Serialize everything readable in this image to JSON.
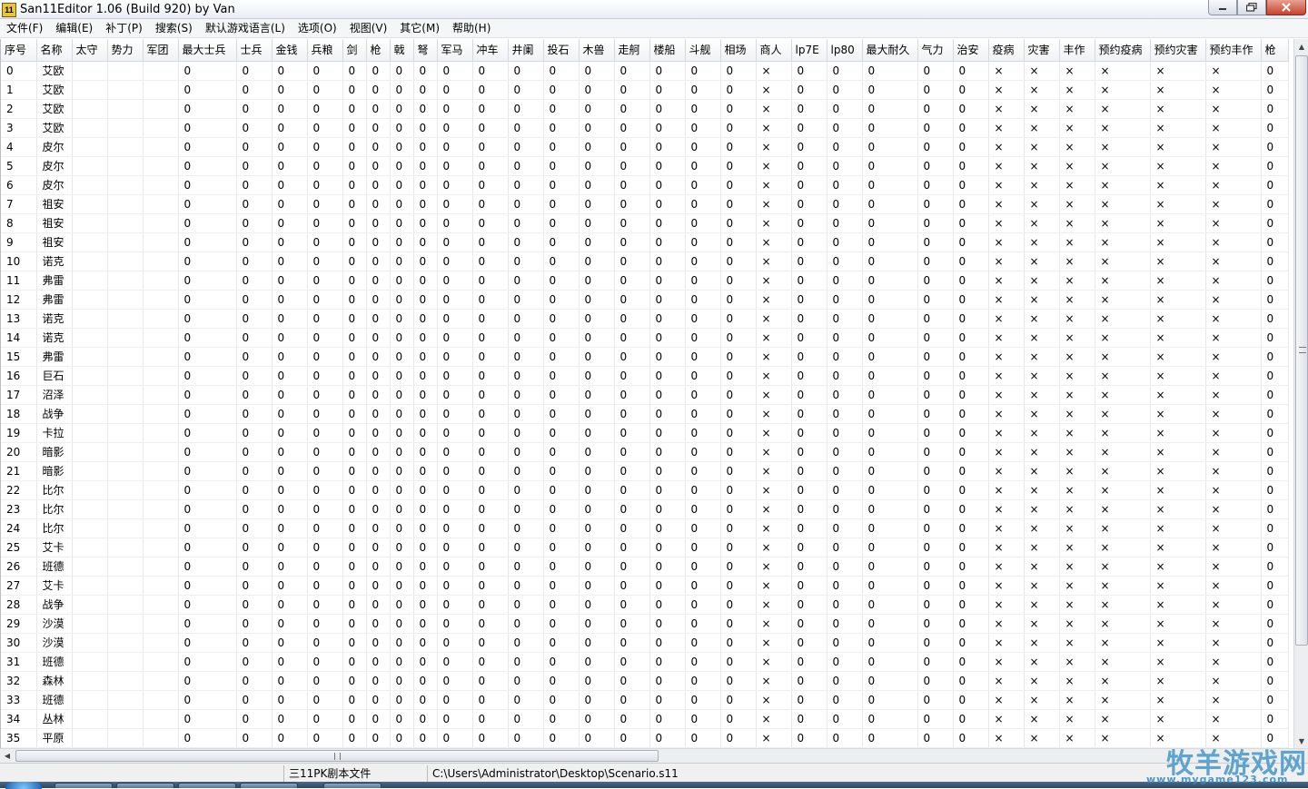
{
  "window": {
    "title": "San11Editor 1.06 (Build 920) by Van",
    "icon_label": "11",
    "min_icon": "minimize-icon",
    "max_icon": "maximize-icon",
    "close_icon": "close-icon"
  },
  "menu": [
    {
      "label": "文件(F)"
    },
    {
      "label": "编辑(E)"
    },
    {
      "label": "补丁(P)"
    },
    {
      "label": "搜索(S)"
    },
    {
      "label": "默认游戏语言(L)"
    },
    {
      "label": "选项(O)"
    },
    {
      "label": "视图(V)"
    },
    {
      "label": "其它(M)"
    },
    {
      "label": "帮助(H)"
    }
  ],
  "table": {
    "columns": [
      "序号",
      "名称",
      "太守",
      "势力",
      "军团",
      "最大士兵",
      "士兵",
      "金钱",
      "兵粮",
      "剑",
      "枪",
      "戟",
      "弩",
      "军马",
      "冲车",
      "井阑",
      "投石",
      "木兽",
      "走舸",
      "楼船",
      "斗舰",
      "相场",
      "商人",
      "lp7E",
      "lp80",
      "最大耐久",
      "气力",
      "治安",
      "疫病",
      "灾害",
      "丰作",
      "预约疫病",
      "预约灾害",
      "预约丰作",
      "枪"
    ],
    "x_columns": [
      22,
      28,
      29,
      30,
      31,
      32,
      33
    ],
    "zero_value": "0",
    "x_value": "×",
    "rows": [
      {
        "id": "0",
        "name": "艾欧"
      },
      {
        "id": "1",
        "name": "艾欧"
      },
      {
        "id": "2",
        "name": "艾欧"
      },
      {
        "id": "3",
        "name": "艾欧"
      },
      {
        "id": "4",
        "name": "皮尔"
      },
      {
        "id": "5",
        "name": "皮尔"
      },
      {
        "id": "6",
        "name": "皮尔"
      },
      {
        "id": "7",
        "name": "祖安"
      },
      {
        "id": "8",
        "name": "祖安"
      },
      {
        "id": "9",
        "name": "祖安"
      },
      {
        "id": "10",
        "name": "诺克"
      },
      {
        "id": "11",
        "name": "弗雷"
      },
      {
        "id": "12",
        "name": "弗雷"
      },
      {
        "id": "13",
        "name": "诺克"
      },
      {
        "id": "14",
        "name": "诺克"
      },
      {
        "id": "15",
        "name": "弗雷"
      },
      {
        "id": "16",
        "name": "巨石"
      },
      {
        "id": "17",
        "name": "沼泽"
      },
      {
        "id": "18",
        "name": "战争"
      },
      {
        "id": "19",
        "name": "卡拉"
      },
      {
        "id": "20",
        "name": "暗影"
      },
      {
        "id": "21",
        "name": "暗影"
      },
      {
        "id": "22",
        "name": "比尔"
      },
      {
        "id": "23",
        "name": "比尔"
      },
      {
        "id": "24",
        "name": "比尔"
      },
      {
        "id": "25",
        "name": "艾卡"
      },
      {
        "id": "26",
        "name": "班德"
      },
      {
        "id": "27",
        "name": "艾卡"
      },
      {
        "id": "28",
        "name": "战争"
      },
      {
        "id": "29",
        "name": "沙漠"
      },
      {
        "id": "30",
        "name": "沙漠"
      },
      {
        "id": "31",
        "name": "班德"
      },
      {
        "id": "32",
        "name": "森林"
      },
      {
        "id": "33",
        "name": "班德"
      },
      {
        "id": "34",
        "name": "丛林"
      },
      {
        "id": "35",
        "name": "平原"
      }
    ]
  },
  "status": {
    "file_type": "三11PK剧本文件",
    "file_path": "C:\\Users\\Administrator\\Desktop\\Scenario.s11"
  },
  "watermark": {
    "text": "牧羊游戏网",
    "url": "www.mygame123.com"
  }
}
